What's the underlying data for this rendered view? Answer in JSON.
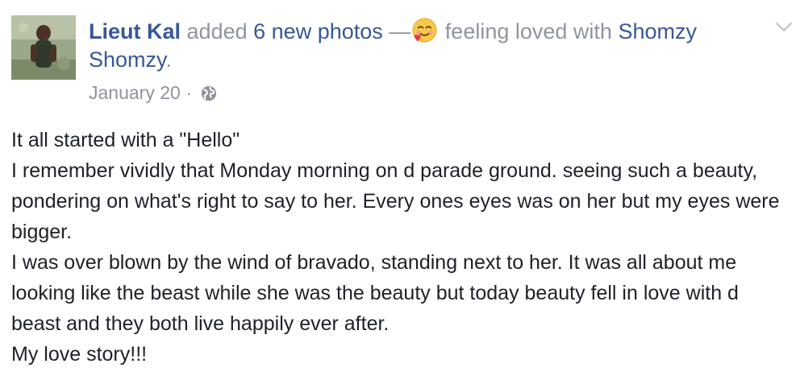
{
  "post": {
    "author": "Lieut Kal",
    "action": "added",
    "photo_count": "6 new photos",
    "dash": "—",
    "emoji": "smiling-face-with-hearts",
    "feeling": "feeling loved with",
    "tagged": "Shomzy Shomzy",
    "tagged_suffix": ".",
    "date": "January 20",
    "separator": "·",
    "privacy": "public-globe-icon",
    "body_lines": [
      "It all started with a \"Hello\"",
      "I remember vividly that Monday morning on d parade ground. seeing such a beauty, pondering on what's right to say to her. Every ones eyes was on her but my eyes were bigger.",
      "I was over blown by the wind of bravado, standing next to her. It was all about me looking like the beast while she was the beauty but today beauty fell in love with d beast and they both live happily ever after.",
      "My love story!!!"
    ]
  },
  "colors": {
    "link": "#365899",
    "meta": "#90949c",
    "text": "#1d2129"
  }
}
